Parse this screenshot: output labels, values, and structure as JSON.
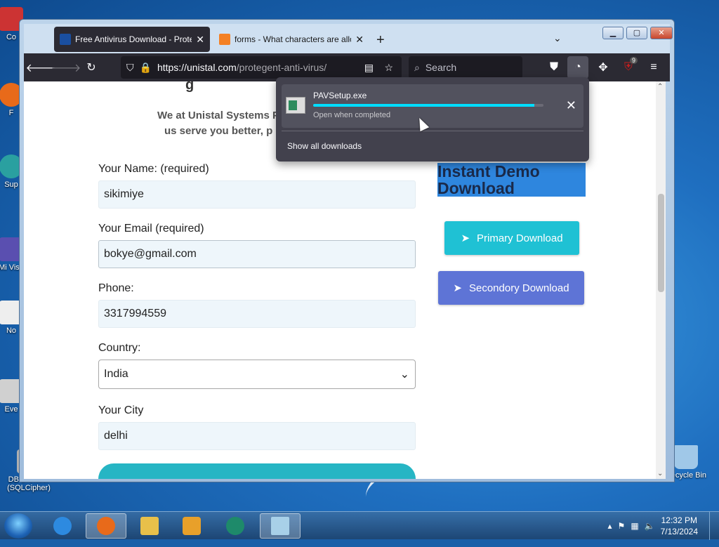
{
  "desktop": {
    "icons": [
      {
        "label": "Co",
        "color": "#cc3333"
      },
      {
        "label": "F",
        "color": "#e86a1a"
      },
      {
        "label": "Sup",
        "color": "#2aa0a0"
      },
      {
        "label": "Mi Visu",
        "color": "#5a4fb0"
      },
      {
        "label": "No",
        "color": "#eeeeee"
      },
      {
        "label": "Eve",
        "color": "#d0d0d0"
      },
      {
        "label": "DB Browser (SQLCipher)",
        "color": "#b0b0b0"
      },
      {
        "label": "Recycle Bin",
        "color": "#a0c8e8"
      }
    ]
  },
  "browser": {
    "tabs": [
      {
        "label": "Free Antivirus Download - Prote",
        "favicon_color": "#1a4fa0",
        "active": true
      },
      {
        "label": "forms - What characters are allo",
        "favicon_color": "#f48024",
        "active": false
      }
    ],
    "new_tab_symbol": "+",
    "tab_list_symbol": "⌄",
    "url": {
      "host": "https://unistal.com",
      "path": "/protegent-anti-virus/"
    },
    "search_placeholder": "Search",
    "extension_badge": "9"
  },
  "page": {
    "heading_partial": "g",
    "intro_line1": "We at Unistal Systems P",
    "intro_line2": "us serve you better, p",
    "form": {
      "name_label": "Your Name: (required)",
      "name_value": "sikimiye",
      "email_label": "Your Email (required)",
      "email_value": "bokye@gmail.com",
      "phone_label": "Phone:",
      "phone_value": "3317994559",
      "country_label": "Country:",
      "country_value": "India",
      "city_label": "Your City",
      "city_value": "delhi"
    },
    "demo_heading_line1": "Instant Demo",
    "demo_heading_line2": "Download",
    "primary_download": "Primary Download",
    "secondary_download": "Secondory Download"
  },
  "downloads_panel": {
    "file_name": "PAVSetup.exe",
    "status": "Open when completed",
    "progress": 0.96,
    "show_all": "Show all downloads"
  },
  "taskbar": {
    "time": "12:32 PM",
    "date": "7/13/2024"
  }
}
